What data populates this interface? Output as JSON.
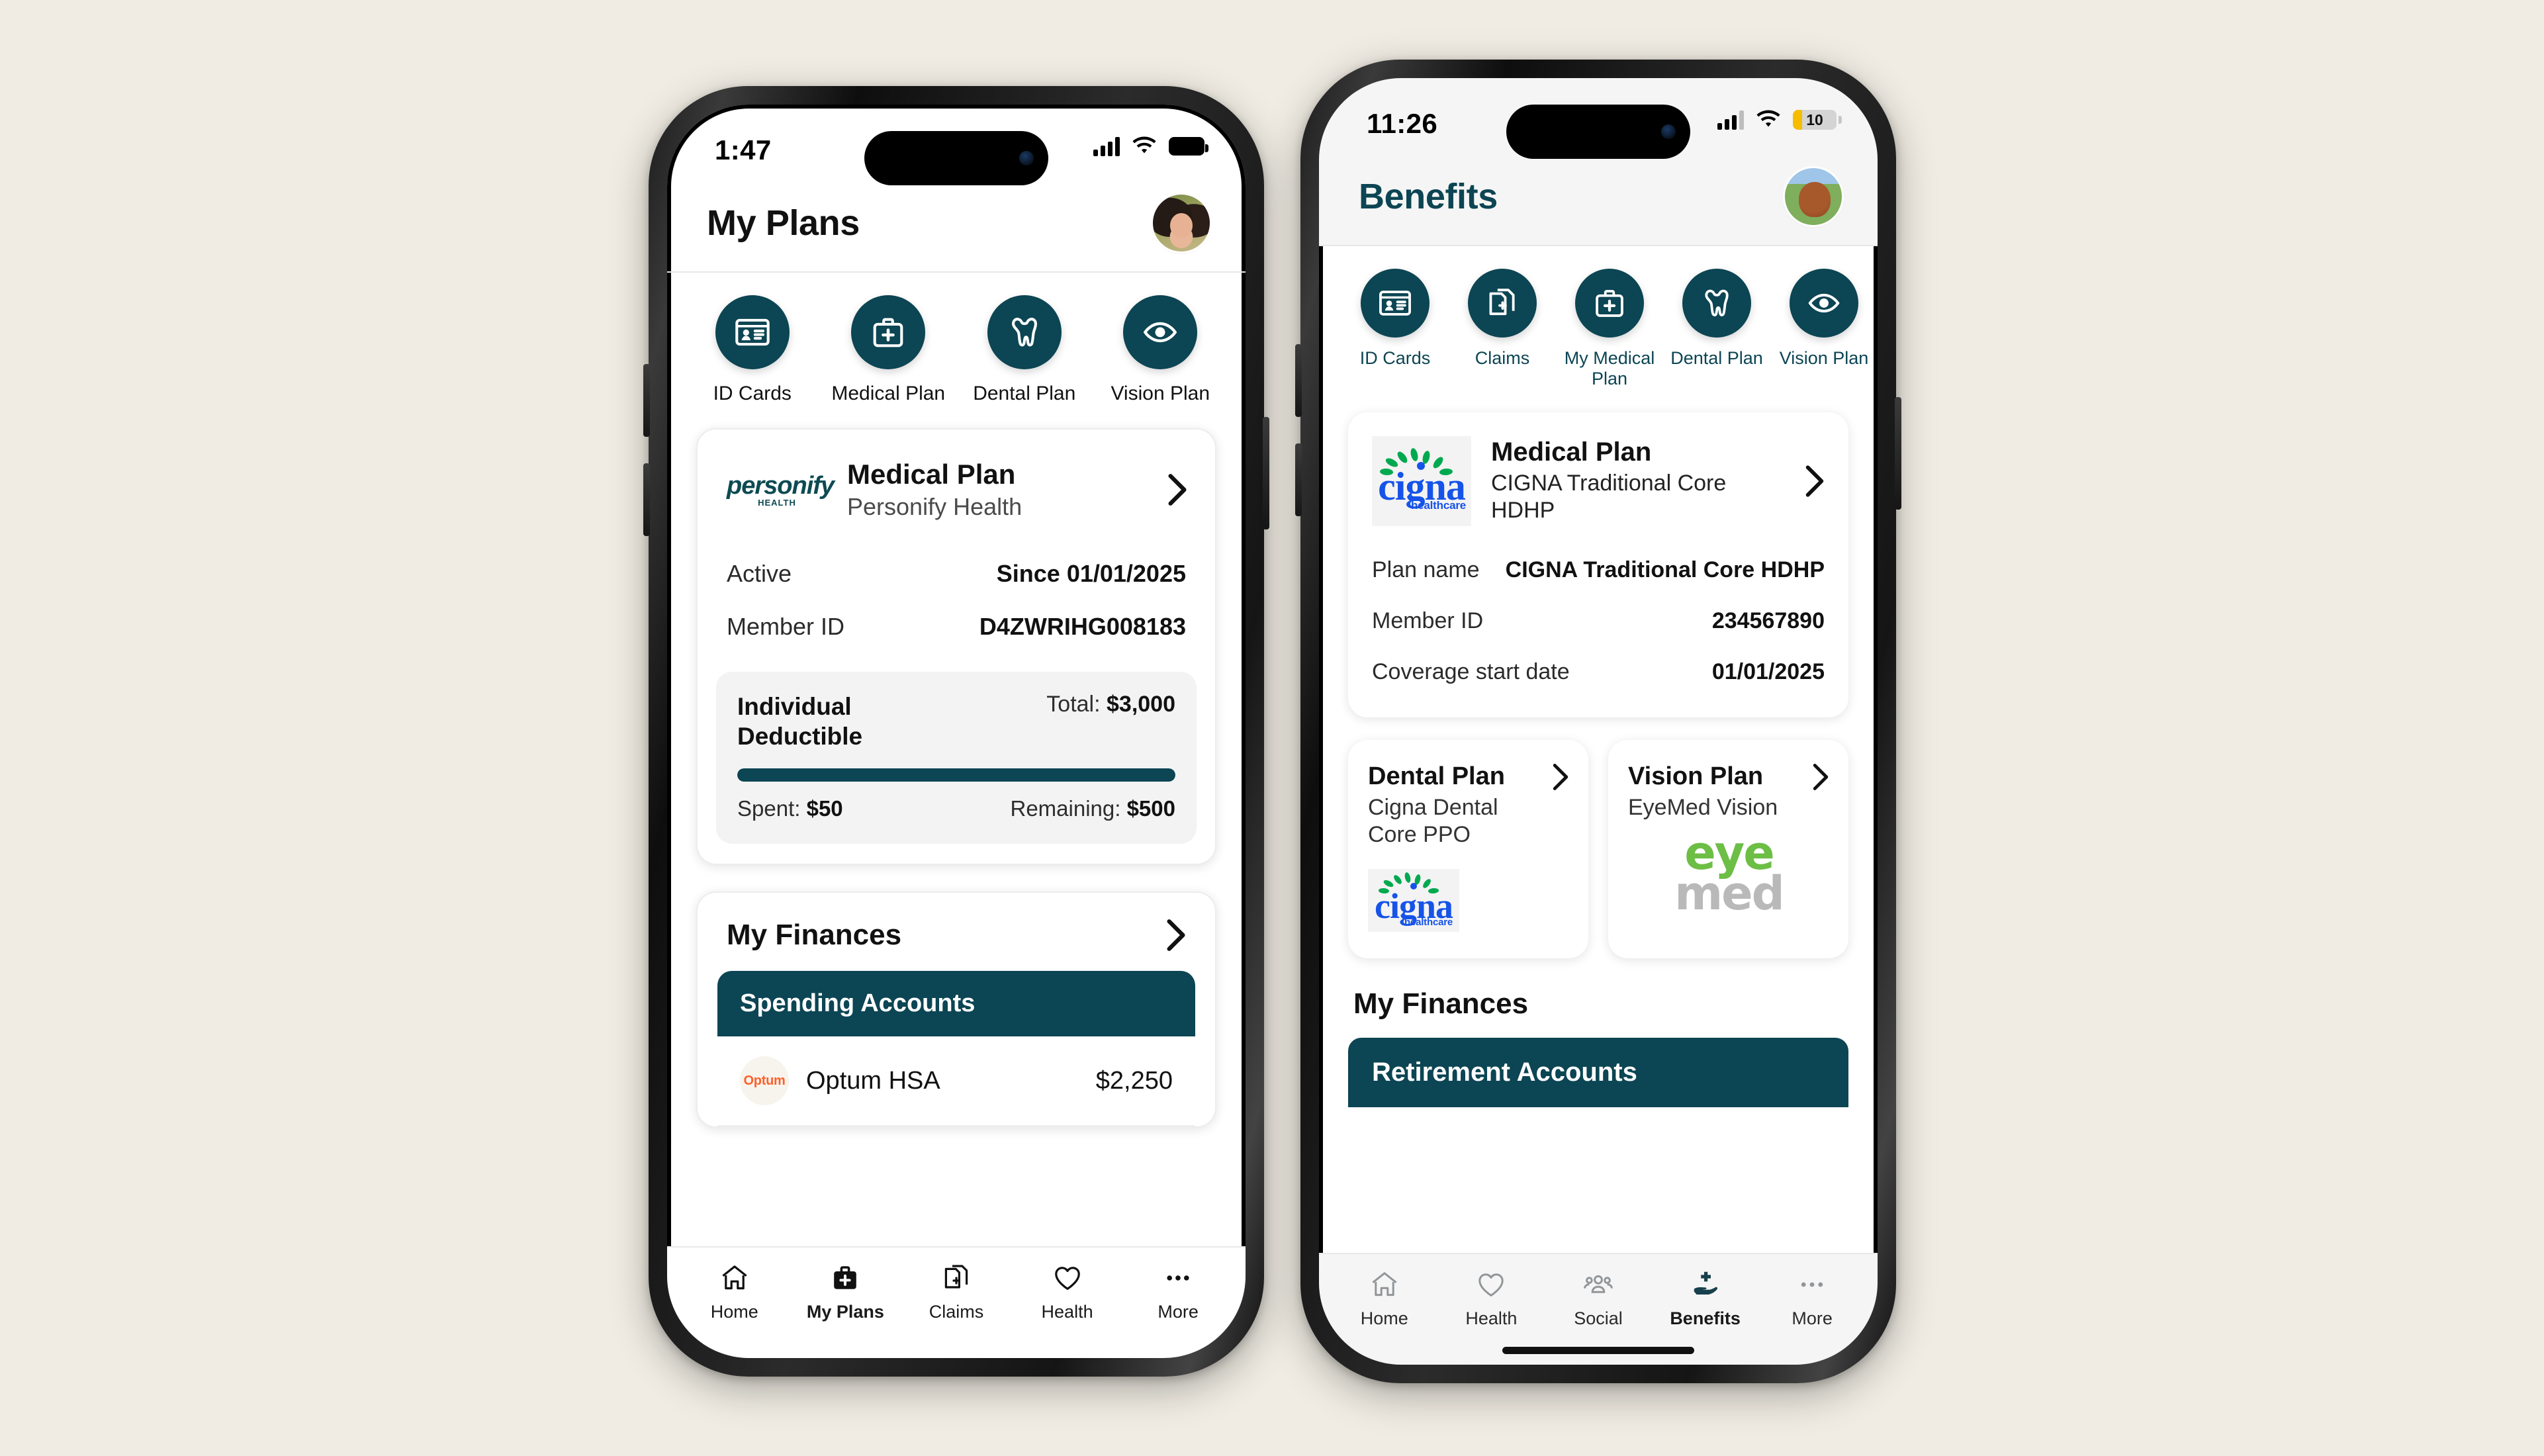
{
  "canvas": {
    "background_color": "#f0ece3",
    "accent_teal": "#0c4553"
  },
  "left_phone": {
    "status_bar": {
      "time": "1:47",
      "signal": "signal-bars",
      "wifi": "wifi",
      "battery": "battery-full"
    },
    "header": {
      "title": "My Plans",
      "avatar": "user-avatar-woman"
    },
    "quick_actions": [
      {
        "label": "ID Cards",
        "icon": "id-card-icon"
      },
      {
        "label": "Medical Plan",
        "icon": "medical-bag-icon"
      },
      {
        "label": "Dental Plan",
        "icon": "tooth-icon"
      },
      {
        "label": "Vision Plan",
        "icon": "eye-icon"
      }
    ],
    "plan_card": {
      "logo": "personify-health-logo",
      "logo_text": "personify",
      "logo_subtext": "HEALTH",
      "title": "Medical Plan",
      "subtitle": "Personify Health",
      "rows": [
        {
          "key": "Active",
          "value": "Since 01/01/2025"
        },
        {
          "key": "Member ID",
          "value": "D4ZWRIHG008183"
        }
      ],
      "deductible": {
        "name": "Individual Deductible",
        "total_label": "Total:",
        "total_value": "$3,000",
        "progress_percent": 100,
        "spent_label": "Spent:",
        "spent_value": "$50",
        "remaining_label": "Remaining:",
        "remaining_value": "$500"
      }
    },
    "finances": {
      "title": "My Finances",
      "banner": "Spending Accounts",
      "accounts": [
        {
          "logo_text": "Optum",
          "name": "Optum HSA",
          "amount": "$2,250"
        }
      ]
    },
    "tabbar": [
      {
        "label": "Home",
        "icon": "home-icon",
        "active": false
      },
      {
        "label": "My Plans",
        "icon": "medical-bag-icon",
        "active": true
      },
      {
        "label": "Claims",
        "icon": "claims-document-icon",
        "active": false
      },
      {
        "label": "Health",
        "icon": "heart-icon",
        "active": false
      },
      {
        "label": "More",
        "icon": "ellipsis-icon",
        "active": false
      }
    ]
  },
  "right_phone": {
    "status_bar": {
      "time": "11:26",
      "signal": "signal-bars",
      "wifi": "wifi",
      "battery_percent": "10"
    },
    "header": {
      "title": "Benefits",
      "avatar": "user-avatar-dog"
    },
    "quick_actions": [
      {
        "label": "ID Cards",
        "icon": "id-card-icon"
      },
      {
        "label": "Claims",
        "icon": "claims-document-icon"
      },
      {
        "label": "My Medical Plan",
        "icon": "medical-bag-icon"
      },
      {
        "label": "Dental Plan",
        "icon": "tooth-icon"
      },
      {
        "label": "Vision Plan",
        "icon": "eye-icon"
      }
    ],
    "plan_card": {
      "logo": "cigna-healthcare-logo",
      "logo_text": "cigna",
      "logo_subtext": "healthcare",
      "title": "Medical Plan",
      "subtitle": "CIGNA Traditional Core HDHP",
      "rows": [
        {
          "key": "Plan name",
          "value": "CIGNA Traditional Core HDHP"
        },
        {
          "key": "Member ID",
          "value": "234567890"
        },
        {
          "key": "Coverage start date",
          "value": "01/01/2025"
        }
      ]
    },
    "duo_cards": [
      {
        "title": "Dental Plan",
        "subtitle": "Cigna Dental Core PPO",
        "logo": "cigna-healthcare-logo",
        "logo_text": "cigna",
        "logo_subtext": "healthcare"
      },
      {
        "title": "Vision Plan",
        "subtitle": "EyeMed Vision",
        "logo": "eyemed-logo",
        "logo_text_a": "eye",
        "logo_text_b": "med"
      }
    ],
    "finances": {
      "title": "My Finances",
      "banner": "Retirement Accounts"
    },
    "tabbar": [
      {
        "label": "Home",
        "icon": "home-icon",
        "active": false
      },
      {
        "label": "Health",
        "icon": "heart-icon",
        "active": false
      },
      {
        "label": "Social",
        "icon": "people-group-icon",
        "active": false
      },
      {
        "label": "Benefits",
        "icon": "hand-holding-cross-icon",
        "active": true
      },
      {
        "label": "More",
        "icon": "ellipsis-icon",
        "active": false
      }
    ]
  }
}
